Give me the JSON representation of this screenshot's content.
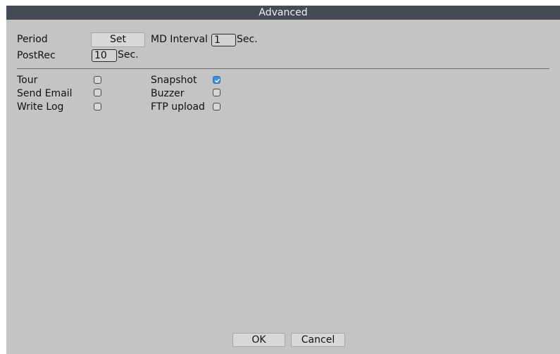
{
  "window": {
    "title": "Advanced"
  },
  "settings": {
    "period_label": "Period",
    "set_button_label": "Set",
    "md_interval_label": "MD Interval",
    "md_interval_value": "1",
    "md_interval_unit": "Sec.",
    "postrec_label": "PostRec",
    "postrec_value": "10",
    "postrec_unit": "Sec."
  },
  "options": {
    "tour": {
      "label": "Tour",
      "checked": false
    },
    "send_email": {
      "label": "Send Email",
      "checked": false
    },
    "write_log": {
      "label": "Write Log",
      "checked": false
    },
    "snapshot": {
      "label": "Snapshot",
      "checked": true
    },
    "buzzer": {
      "label": "Buzzer",
      "checked": false
    },
    "ftp_upload": {
      "label": "FTP upload",
      "checked": false
    }
  },
  "footer": {
    "ok_label": "OK",
    "cancel_label": "Cancel"
  },
  "colors": {
    "titlebar": "#454b55",
    "panel": "#c4c4c4",
    "checkbox_checked": "#3d8fd9"
  }
}
